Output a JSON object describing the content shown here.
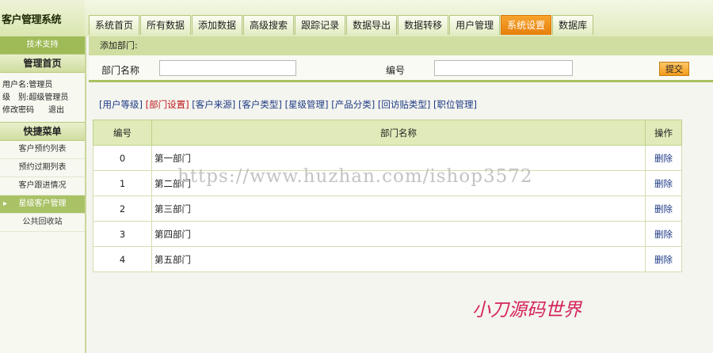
{
  "sidebar": {
    "app_title": "客户管理系统",
    "tech_support": "技术支持",
    "home_heading": "管理首页",
    "user_label": "用户名:",
    "user_value": "管理员",
    "role_label": "级　别:",
    "role_value": "超级管理员",
    "change_password": "修改密码",
    "logout": "退出",
    "quick_heading": "快捷菜单",
    "items": [
      {
        "label": "客户预约列表"
      },
      {
        "label": "预约过期列表"
      },
      {
        "label": "客户跟进情况"
      },
      {
        "label": "星级客户管理"
      },
      {
        "label": "公共回收站"
      }
    ]
  },
  "tabs": [
    {
      "label": "系统首页"
    },
    {
      "label": "所有数据"
    },
    {
      "label": "添加数据"
    },
    {
      "label": "高级搜索"
    },
    {
      "label": "跟踪记录"
    },
    {
      "label": "数据导出"
    },
    {
      "label": "数据转移"
    },
    {
      "label": "用户管理"
    },
    {
      "label": "系统设置"
    },
    {
      "label": "数据库"
    }
  ],
  "form": {
    "section_title": "添加部门:",
    "dept_name_label": "部门名称",
    "dept_name_value": "",
    "number_label": "编号",
    "number_value": "",
    "submit_label": "提交"
  },
  "settings_links": [
    {
      "label": "[用户等级]"
    },
    {
      "label": "[部门设置]"
    },
    {
      "label": "[客户来源]"
    },
    {
      "label": "[客户类型]"
    },
    {
      "label": "[星级管理]"
    },
    {
      "label": "[产品分类]"
    },
    {
      "label": "[回访贴类型]"
    },
    {
      "label": "[职位管理]"
    }
  ],
  "table": {
    "headers": {
      "id": "编号",
      "name": "部门名称",
      "op": "操作"
    },
    "rows": [
      {
        "id": "0",
        "name": "第一部门",
        "op": "删除"
      },
      {
        "id": "1",
        "name": "第二部门",
        "op": "删除"
      },
      {
        "id": "2",
        "name": "第三部门",
        "op": "删除"
      },
      {
        "id": "3",
        "name": "第四部门",
        "op": "删除"
      },
      {
        "id": "4",
        "name": "第五部门",
        "op": "删除"
      }
    ]
  },
  "watermark": "https://www.huzhan.com/ishop3572",
  "brand_mark": "小刀源码世界",
  "colors": {
    "accent": "#f39a1c",
    "sidebar_active": "#a9c266",
    "header_green": "#d0dea1"
  }
}
